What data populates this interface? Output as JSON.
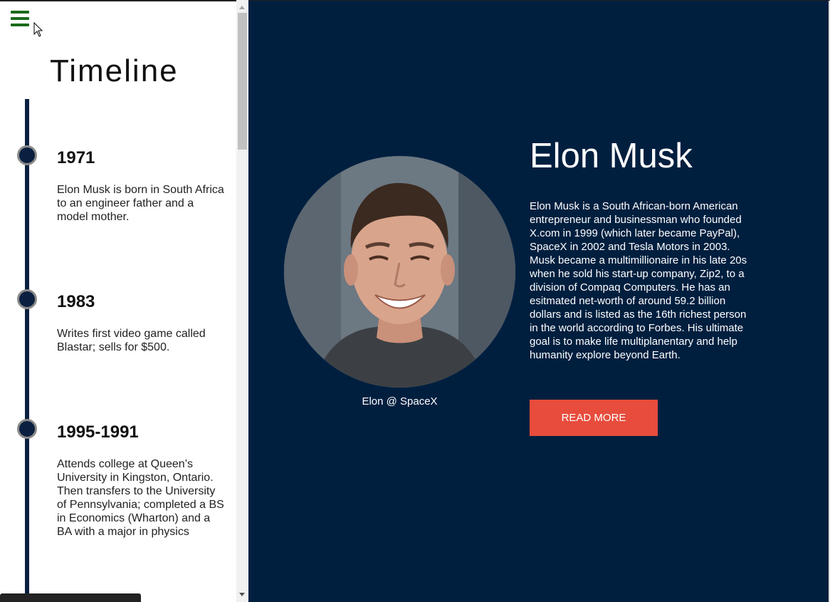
{
  "sidebar": {
    "title": "Timeline",
    "events": [
      {
        "year": "1971",
        "text": "Elon Musk is born in South Africa to an engineer father and a model mother."
      },
      {
        "year": "1983",
        "text": "Writes first video game called Blastar; sells for $500."
      },
      {
        "year": "1995-1991",
        "text": "Attends college at Queen’s University in Kingston, Ontario. Then transfers to the University of Pennsylvania; completed a BS in Economics (Wharton) and a BA with a major in physics"
      }
    ]
  },
  "main": {
    "name": "Elon Musk",
    "caption": "Elon @ SpaceX",
    "bio": "Elon Musk is a South African-born American entrepreneur and businessman who founded X.com in 1999 (which later became PayPal), SpaceX in 2002 and Tesla Motors in 2003. Musk became a multimillionaire in his late 20s when he sold his start-up company, Zip2, to a division of Compaq Computers. He has an esitmated net-worth of around 59.2 billion dollars and is listed as the 16th richest person in the world according to Forbes. His ultimate goal is to make life multiplanentary and help humanity explore beyond Earth.",
    "read_more_label": "READ MORE"
  },
  "icons": {
    "menu": "hamburger-menu-icon",
    "cursor": "mouse-cursor-icon"
  },
  "colors": {
    "main_bg": "#001f3f",
    "timeline": "#0a2040",
    "button": "#e74c3c",
    "menu_icon": "#1a6b1a"
  }
}
